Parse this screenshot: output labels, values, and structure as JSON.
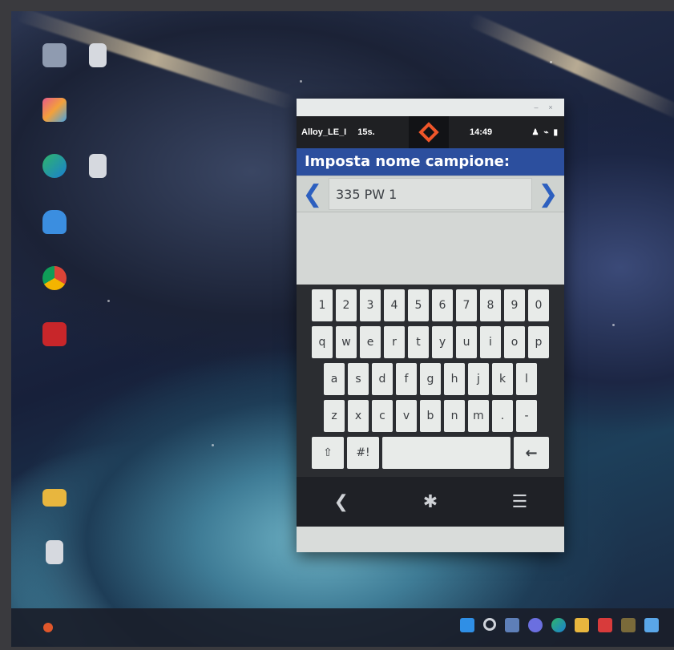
{
  "colors": {
    "header_bg": "#2c4f9e",
    "arrow": "#2c5fbf",
    "logo": "#f0562a",
    "statusbar_bg": "#1f2023"
  },
  "desktop": {
    "icons": [
      {
        "name": "recycle-bin-icon"
      },
      {
        "name": "document-icon"
      },
      {
        "name": "photos-app-icon"
      },
      {
        "name": "edge-browser-icon"
      },
      {
        "name": "document-icon"
      },
      {
        "name": "onedrive-icon"
      },
      {
        "name": "chrome-browser-icon"
      },
      {
        "name": "acrobat-reader-icon"
      },
      {
        "name": "folder-icon"
      },
      {
        "name": "document-icon"
      }
    ]
  },
  "app": {
    "status": {
      "mode": "Alloy_LE_I",
      "duration": "15s.",
      "time": "14:49",
      "icons": [
        "user-icon",
        "wifi-icon",
        "battery-icon"
      ]
    },
    "header_title": "Imposta nome campione:",
    "sample_name": "335 PW 1",
    "prev_arrow": "❮",
    "next_arrow": "❯",
    "keyboard": {
      "row1": [
        "1",
        "2",
        "3",
        "4",
        "5",
        "6",
        "7",
        "8",
        "9",
        "0"
      ],
      "row2": [
        "q",
        "w",
        "e",
        "r",
        "t",
        "y",
        "u",
        "i",
        "o",
        "p"
      ],
      "row3": [
        "a",
        "s",
        "d",
        "f",
        "g",
        "h",
        "j",
        "k",
        "l"
      ],
      "row4": [
        "z",
        "x",
        "c",
        "v",
        "b",
        "n",
        "m",
        ".",
        "-"
      ],
      "shift": "⇧",
      "symbols": "#!",
      "space": "",
      "backspace": "←"
    },
    "nav": {
      "back": "❮",
      "settings": "✱",
      "menu": "☰"
    }
  }
}
